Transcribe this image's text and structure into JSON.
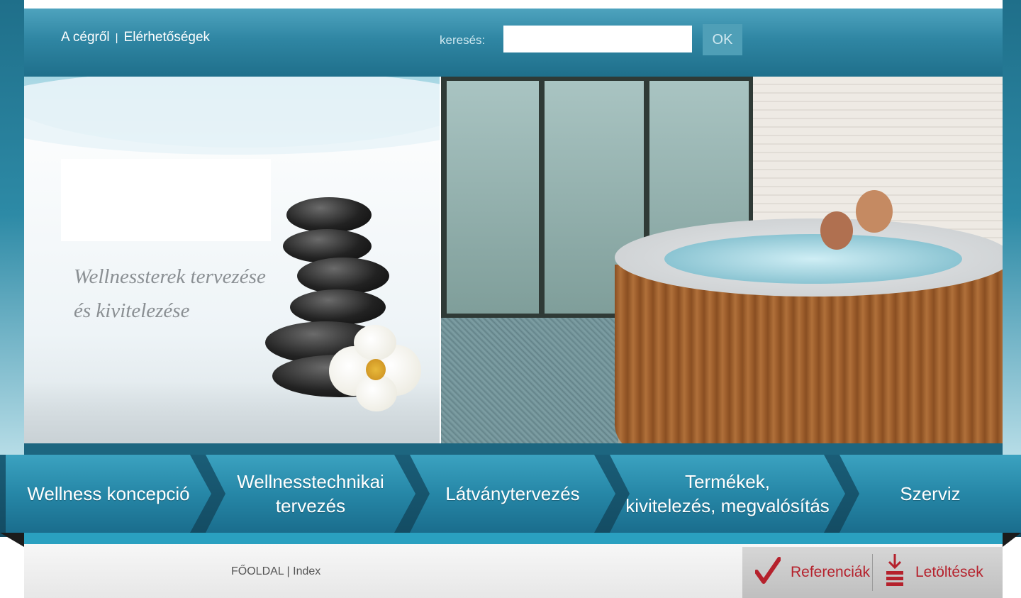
{
  "header": {
    "links": [
      "A cégről",
      "Elérhetőségek"
    ],
    "link_separator": "|",
    "search_label": "keresés:",
    "search_value": "",
    "search_button": "OK"
  },
  "hero": {
    "tagline_line1": "Wellnessterek tervezése",
    "tagline_line2": "és kivitelezése"
  },
  "nav": {
    "items": [
      {
        "label": "Wellness koncepció"
      },
      {
        "label_line1": "Wellnesstechnikai",
        "label_line2": "tervezés"
      },
      {
        "label": "Látványtervezés"
      },
      {
        "label_line1": "Termékek,",
        "label_line2": "kivitelezés, megvalósítás"
      },
      {
        "label": "Szerviz"
      }
    ]
  },
  "footer": {
    "breadcrumb_home": "FŐOLDAL",
    "breadcrumb_sep": "|",
    "breadcrumb_current": "Index",
    "references_label": "Referenciák",
    "downloads_label": "Letöltések"
  },
  "colors": {
    "brand": "#2687a7",
    "accent_red": "#b5212c"
  }
}
